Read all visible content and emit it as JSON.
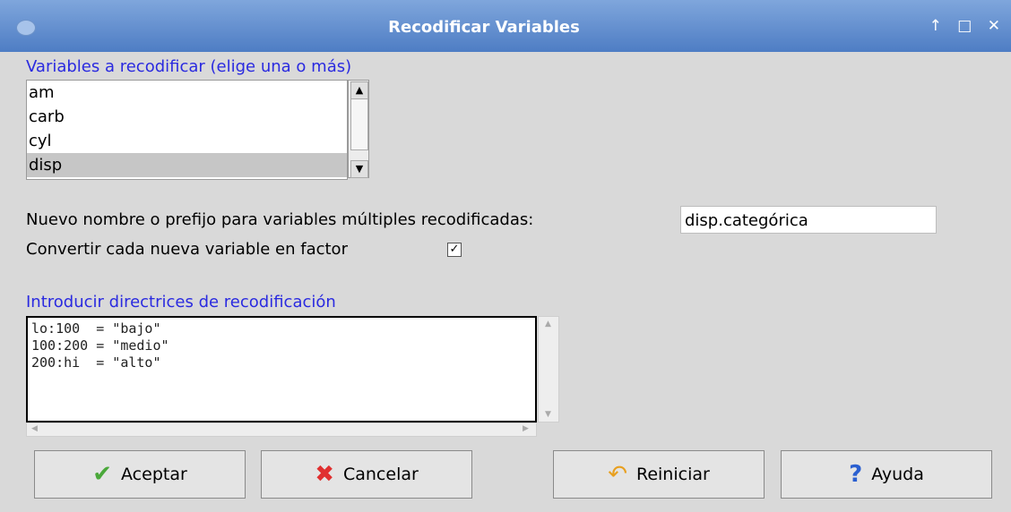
{
  "window": {
    "title": "Recodificar Variables",
    "controls": [
      "↑",
      "□",
      "✕"
    ]
  },
  "variables": {
    "label": "Variables a recodificar (elige una o más)",
    "items": [
      "am",
      "carb",
      "cyl",
      "disp"
    ],
    "selected": "disp"
  },
  "name_field": {
    "label": "Nuevo nombre o prefijo para variables múltiples recodificadas:",
    "value": "disp.categórica"
  },
  "factor": {
    "label": "Convertir cada nueva variable en factor",
    "checked": true
  },
  "directives": {
    "label": "Introducir directrices de recodificación",
    "lines": [
      "lo:100  = \"bajo\"",
      "100:200 = \"medio\"",
      "200:hi  = \"alto\""
    ]
  },
  "buttons": {
    "ok": "Aceptar",
    "cancel": "Cancelar",
    "reset": "Reiniciar",
    "help": "Ayuda"
  },
  "colors": {
    "label_blue": "#2a2ae0",
    "ok_icon": "#4aa83a",
    "cancel_icon": "#e03030",
    "reset_icon": "#e8a020",
    "help_icon": "#2a5fd0"
  }
}
